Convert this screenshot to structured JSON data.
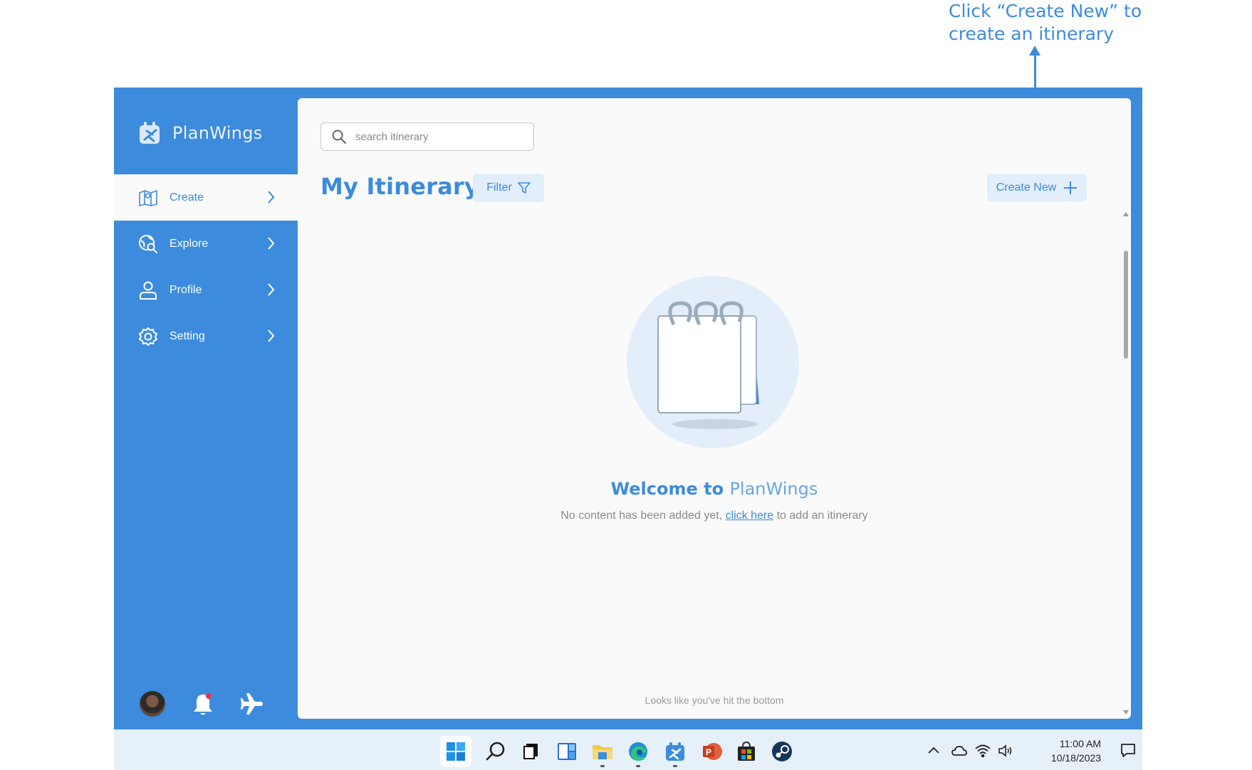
{
  "annotation": {
    "line1": "Click “Create New” to",
    "line2": "create an itinerary"
  },
  "brand": {
    "name": "PlanWings"
  },
  "nav": {
    "items": [
      {
        "label": "Create",
        "icon": "map-icon",
        "active": true
      },
      {
        "label": "Explore",
        "icon": "globe-search-icon",
        "active": false
      },
      {
        "label": "Profile",
        "icon": "user-icon",
        "active": false
      },
      {
        "label": "Setting",
        "icon": "gear-icon",
        "active": false
      }
    ]
  },
  "search": {
    "placeholder": "search itinerary",
    "value": ""
  },
  "main": {
    "title": "My Itinerary",
    "filter_label": "Filter",
    "create_label": "Create New",
    "welcome_prefix": "Welcome to ",
    "welcome_brand": "PlanWings",
    "empty_prefix": "No content has been added yet, ",
    "empty_link": "click here",
    "empty_suffix": " to add an itinerary",
    "bottom_note": "Looks like you've hit the bottom"
  },
  "taskbar": {
    "time": "11:00 AM",
    "date": "10/18/2023",
    "apps": [
      "start-icon",
      "search-icon",
      "task-view-icon",
      "widgets-icon",
      "file-explorer-icon",
      "edge-icon",
      "planwings-icon",
      "powerpoint-icon",
      "store-icon",
      "steam-icon"
    ]
  },
  "colors": {
    "accent": "#3d8bdc",
    "panel": "#fafafa",
    "button_bg": "#e2eefa",
    "taskbar": "#e6f0f8"
  }
}
